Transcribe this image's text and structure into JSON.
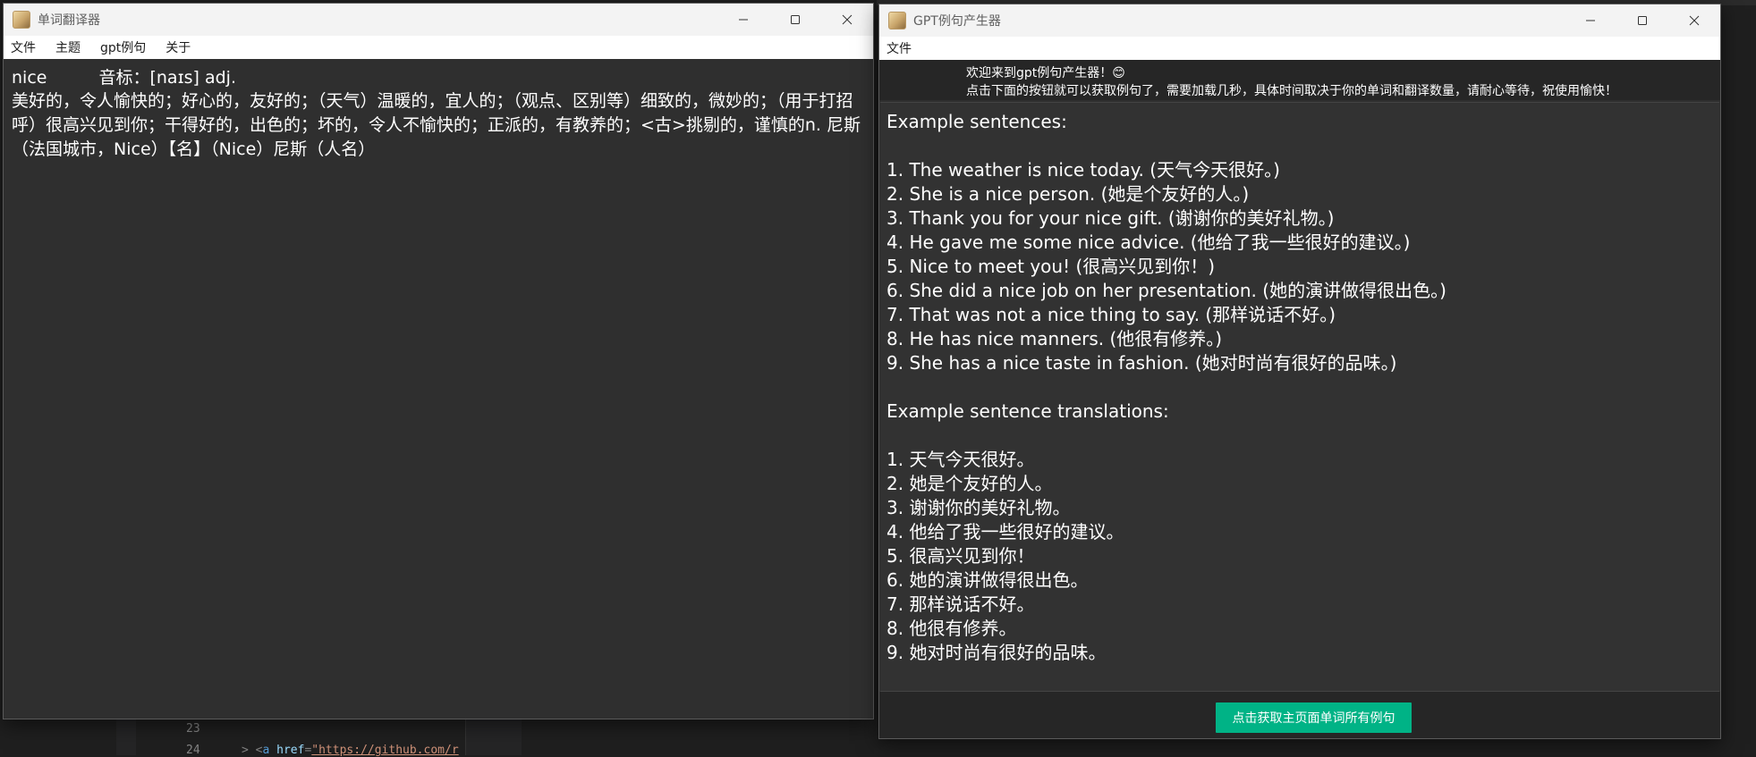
{
  "background": {
    "line_numbers": [
      "23",
      "24"
    ],
    "code_line": {
      "prefix": ">",
      "tag_open": "<",
      "tag_name": "a",
      "attr": "href",
      "equals": "=",
      "value": "\"https://github.com/r"
    }
  },
  "translator_window": {
    "title": "单词翻译器",
    "menu": [
      "文件",
      "主题",
      "gpt例句",
      "关于"
    ],
    "word": "nice",
    "phonetic": "音标：[naɪs] adj.",
    "definition": "美好的，令人愉快的；好心的，友好的；（天气）温暖的，宜人的；（观点、区别等）细致的，微妙的；（用于打招呼）很高兴见到你；干得好的，出色的；坏的，令人不愉快的；正派的，有教养的；<古>挑剔的，谨慎的n. 尼斯（法国城市，Nice）【名】（Nice）尼斯（人名）"
  },
  "gpt_window": {
    "title": "GPT例句产生器",
    "menu": [
      "文件"
    ],
    "welcome_line1": "欢迎来到gpt例句产生器！😊",
    "welcome_line2": "点击下面的按钮就可以获取例句了，需要加载几秒，具体时间取决于你的单词和翻译数量，请耐心等待，祝使用愉快！",
    "sentences_heading": "Example sentences:",
    "sentences": [
      "1. The weather is nice today. (天气今天很好。)",
      "2. She is a nice person. (她是个友好的人。)",
      "3. Thank you for your nice gift. (谢谢你的美好礼物。)",
      "4. He gave me some nice advice. (他给了我一些很好的建议。)",
      "5. Nice to meet you! (很高兴见到你！)",
      "6. She did a nice job on her presentation. (她的演讲做得很出色。)",
      "7. That was not a nice thing to say. (那样说话不好。)",
      "8. He has nice manners. (他很有修养。)",
      "9. She has a nice taste in fashion. (她对时尚有很好的品味。)"
    ],
    "translations_heading": "Example sentence translations:",
    "translations": [
      "1. 天气今天很好。",
      "2. 她是个友好的人。",
      "3. 谢谢你的美好礼物。",
      "4. 他给了我一些很好的建议。",
      "5. 很高兴见到你！",
      "6. 她的演讲做得很出色。",
      "7. 那样说话不好。",
      "8. 他很有修养。",
      "9. 她对时尚有很好的品味。"
    ],
    "fetch_button_label": "点击获取主页面单词所有例句"
  },
  "icons": {
    "app": "app-avatar-icon",
    "minimize": "minimize-icon",
    "maximize": "maximize-icon",
    "close": "close-icon"
  },
  "colors": {
    "accent_button": "#00b386",
    "content_bg": "#2f2f2f",
    "titlebar_bg": "#f3f3f3"
  }
}
